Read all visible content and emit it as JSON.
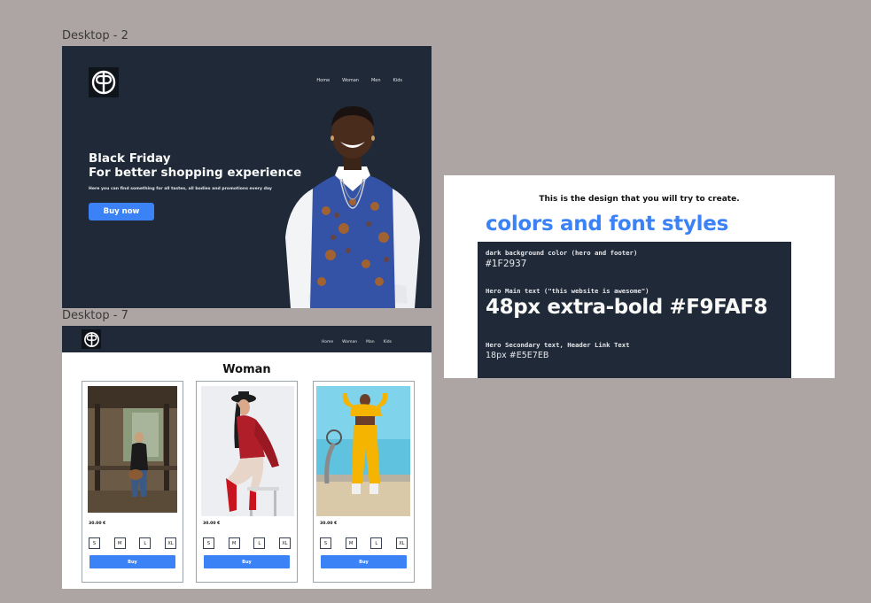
{
  "frames": {
    "desktop2_label": "Desktop - 2",
    "desktop7_label": "Desktop - 7"
  },
  "hero": {
    "nav": [
      "Home",
      "Woman",
      "Men",
      "Kids"
    ],
    "title_line1": "Black Friday",
    "title_line2": "For better shopping experience",
    "subtitle": "Here you can find something for all tastes, all bodies and promotions every day",
    "cta": "Buy now"
  },
  "shop": {
    "nav": [
      "Home",
      "Woman",
      "Man",
      "Kids"
    ],
    "section_title": "Woman",
    "cards": [
      {
        "price": "30.00 €",
        "sizes": [
          "S",
          "M",
          "L",
          "XL"
        ],
        "buy": "Buy"
      },
      {
        "price": "30.00 €",
        "sizes": [
          "S",
          "M",
          "L",
          "XL"
        ],
        "buy": "Buy"
      },
      {
        "price": "30.00 €",
        "sizes": [
          "S",
          "M",
          "L",
          "XL"
        ],
        "buy": "Buy"
      }
    ]
  },
  "guide": {
    "intro": "This is the design that you will try to create.",
    "heading": "colors and font styles",
    "bg_label": "dark background color (hero and footer)",
    "bg_value": "#1F2937",
    "main_label": "Hero Main text (\"this website is awesome\")",
    "main_value": "48px extra-bold #F9FAF8",
    "secondary_label": "Hero Secondary text, Header Link Text",
    "secondary_value": "18px #E5E7EB"
  },
  "colors": {
    "dark": "#1F2937",
    "hero_text": "#F9FAF8",
    "secondary_text": "#E5E7EB",
    "accent": "#3B82F6",
    "canvas": "#ADA5A3"
  }
}
